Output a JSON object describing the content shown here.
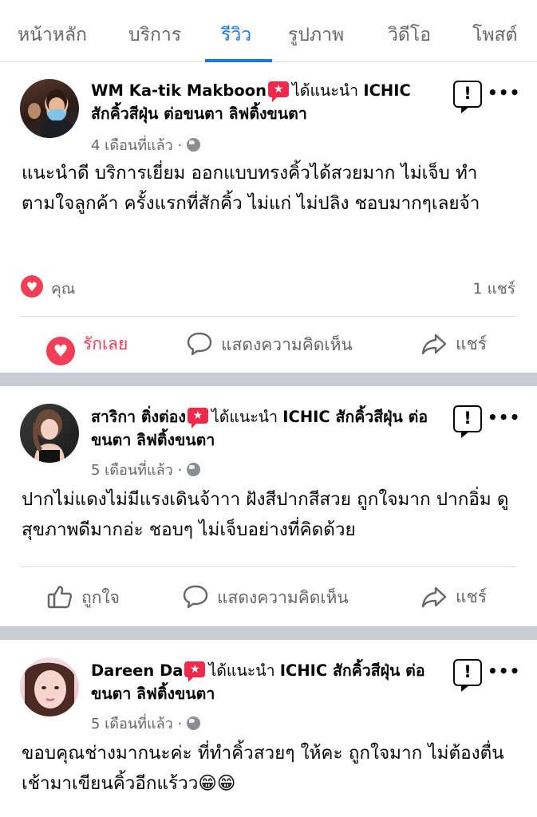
{
  "tabs": [
    "หน้าหลัก",
    "บริการ",
    "รีวิว",
    "รูปภาพ",
    "วิดีโอ",
    "โพสต์"
  ],
  "active_tab": "รีวิว",
  "colors": {
    "brand": "#1877f2",
    "love": "#f33e58",
    "badge": "#f02849",
    "muted": "#65676b"
  },
  "recommend_badge_icon": "star-recommend-icon",
  "report_icon": "report-exclamation-icon",
  "more_icon": "more-dots-icon",
  "posts": [
    {
      "author": "WM Ka-tik Makboon",
      "recommends": "ได้แนะนำ",
      "page": "ICHIC สักคิ้วสีฝุ่น ต่อขนตา ลิฟติ้งขนตา",
      "time": "4 เดือนที่แล้ว ·",
      "text": "แนะนำดี บริการเยี่ยม ออกแบบทรงคิ้วได้สวยมาก ไม่เจ็บ ทำตามใจลูกค้า  ครั้งแรกที่สักคิ้ว ไม่แก่ ไม่ปลิง ชอบมากๆเลยจ้า",
      "reaction_label": "คุณ",
      "shares": "1 แชร์",
      "actions": {
        "react": "รักเลย",
        "comment": "แสดงความคิดเห็น",
        "share": "แชร์"
      }
    },
    {
      "author": "สาริกา ติ่งต่อง",
      "recommends": "ได้แนะนำ",
      "page": "ICHIC สักคิ้วสีฝุ่น ต่อขนตา ลิฟติ้งขนตา",
      "time": "5 เดือนที่แล้ว ·",
      "text": "ปากไม่แดงไม่มีแรงเดินจ้าาา   ฝังสีปากสีสวย ถูกใจมาก ปากอิ่ม ดูสุขภาพดีมากอ่ะ ชอบๆ ไม่เจ็บอย่างที่คิดด้วย",
      "actions": {
        "react": "ถูกใจ",
        "comment": "แสดงความคิดเห็น",
        "share": "แชร์"
      }
    },
    {
      "author": "Dareen Da",
      "recommends": "ได้แนะนำ",
      "page": "ICHIC สักคิ้วสีฝุ่น ต่อขนตา ลิฟติ้งขนตา",
      "time": "5 เดือนที่แล้ว ·",
      "text": "ขอบคุณช่างมากนะค่ะ ที่ทำคิ้วสวยๆ ให้คะ ถูกใจมาก ไม่ต้องตื่นเช้ามาเขียนคิ้วอีกแร้วว😁😁"
    }
  ]
}
